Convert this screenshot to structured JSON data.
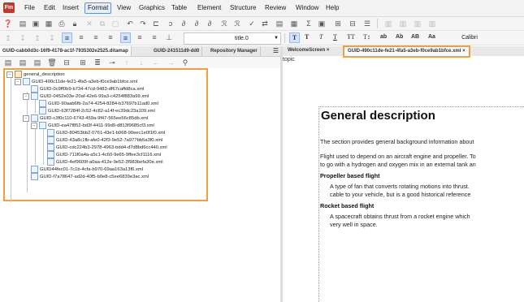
{
  "app": {
    "logo": "Fm"
  },
  "menubar": {
    "items": [
      "File",
      "Edit",
      "Insert",
      "Format",
      "View",
      "Graphics",
      "Table",
      "Element",
      "Structure",
      "Review",
      "Window",
      "Help"
    ],
    "active": "Format"
  },
  "format_toolbar": {
    "style_value": "title.0",
    "font_value": "Calibri",
    "buttons": [
      "T",
      "T",
      "T",
      "T",
      "ŦT",
      "T↕",
      "ab",
      "Ab",
      "AB",
      "Aa"
    ]
  },
  "left_panel": {
    "tabs": [
      "GUID-cabb0d3c-16f9-4178-ac1f-7935302e2525.ditamap",
      "GUID-241511d9-dd0",
      "Repository Manager"
    ],
    "tree": {
      "root": "general_description",
      "items": [
        "GUID-490c11de-fe21-4fa5-a3eb-f0ce9ab1bfce.xml",
        "GUID-0c9ff0b9-b734-47cd-9483-df67caffd8ca.xml",
        "GUID-0452e03e-20af-42e6-99a3-c4254f883a99.xml",
        "GUID-90aab6fb-2a74-4254-8284-b37697b11ad0.xml",
        "GUID-63f7284f-2c52-4c82-a14f-ec39dc23a109.xml",
        "GUID-c3f0c110-6743-459a-9f47-565ee56c85db.xml",
        "GUID-ea47f852-bd3f-4411-99d9-d813f9685cf3.xml",
        "GUID-80453bb2-0761-43e1-b068-90eec1e0f1f0.xml",
        "GUID-43a8c1fb-afe0-42f3-9e52-7a977bb5a3f0.xml",
        "GUID-cdc224b3-2978-4963-bdd4-d7d8bd6cc440.xml",
        "GUID-711f0a4a-a5c1-4c60-9e65-9ffee3cf1116.xml",
        "GUID-4ef9609f-a0aa-412e-9e52-3f983befa30e.xml",
        "GUID44fec01-7c1b-4cfa-b970-69aa163a13f6.xml",
        "GUID-f7a78647-ad2d-40f5-b0e8-c5ee6839e3ac.xml"
      ]
    }
  },
  "editor": {
    "tabs": [
      "WelcomeScreen",
      "GUID-490c11de-fe21-4fa5-a3eb-f0ce9ab1bfce.xml"
    ],
    "close_glyph": "×",
    "breadcrumb": "topic",
    "document": {
      "title": "General description",
      "intro": "The section provides general background information about",
      "para2_line1": "Flight used to depend on an aircraft engine and propeller. To",
      "para2_line2": "to go with a hydrogen and oxygen mix in an external tank an",
      "h1": "Propeller based flight",
      "h1_text_line1": "A type of fan that converts rotating motions into thrust.",
      "h1_text_line2": "cable to your vehicle, but is a good historical reference",
      "h2": "Rocket based flight",
      "h2_text_line1": "A spacecraft obtains thrust from a rocket engine which",
      "h2_text_line2": "very well in space."
    }
  }
}
